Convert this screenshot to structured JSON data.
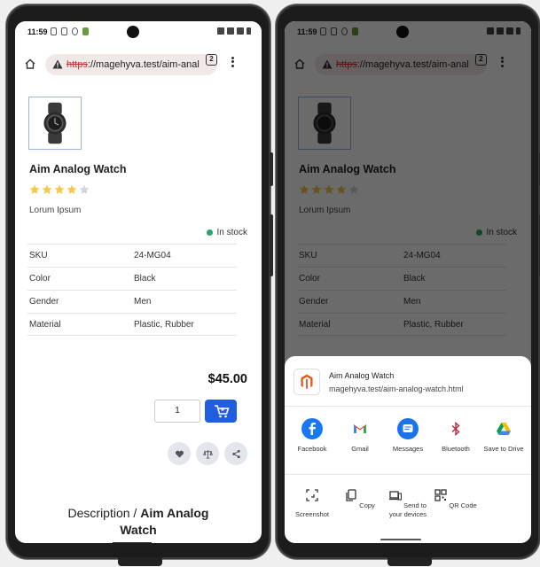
{
  "status": {
    "time": "11:59"
  },
  "browser": {
    "url_scheme": "https",
    "url_rest": "://magehyva.test/aim-anal",
    "tab_count": "2"
  },
  "product": {
    "title": "Aim Analog Watch",
    "rating_stars": 4,
    "rating_max": 5,
    "subtitle": "Lorum Ipsum",
    "stock": "In stock",
    "attributes": [
      {
        "label": "SKU",
        "value": "24-MG04"
      },
      {
        "label": "Color",
        "value": "Black"
      },
      {
        "label": "Gender",
        "value": "Men"
      },
      {
        "label": "Material",
        "value": "Plastic, Rubber"
      }
    ],
    "price": "$45.00",
    "quantity": "1",
    "description_prefix": "Description / ",
    "description_name_1": "Aim Analog",
    "description_name_2": "Watch"
  },
  "share_sheet": {
    "title": "Aim Analog Watch",
    "url": "magehyva.test/aim-analog-watch.html",
    "apps": [
      {
        "label": "Facebook",
        "color": "#1877f2",
        "icon": "facebook-icon"
      },
      {
        "label": "Gmail",
        "color": "#ffffff",
        "icon": "gmail-icon"
      },
      {
        "label": "Messages",
        "color": "#1a73e8",
        "icon": "messages-icon"
      },
      {
        "label": "Bluetooth",
        "color": "#ffffff",
        "icon": "bluetooth-icon"
      },
      {
        "label": "Save to Drive",
        "color": "#ffffff",
        "icon": "drive-icon"
      }
    ],
    "tools": [
      {
        "label": "Screenshot",
        "icon": "screenshot-icon"
      },
      {
        "label": "Copy",
        "icon": "copy-icon"
      },
      {
        "label": "Send to your devices",
        "icon": "devices-icon"
      },
      {
        "label": "QR Code",
        "icon": "qr-code-icon"
      }
    ]
  },
  "colors": {
    "accent": "#1f5ede",
    "stock": "#2aa46b",
    "star": "#f2c94c"
  }
}
